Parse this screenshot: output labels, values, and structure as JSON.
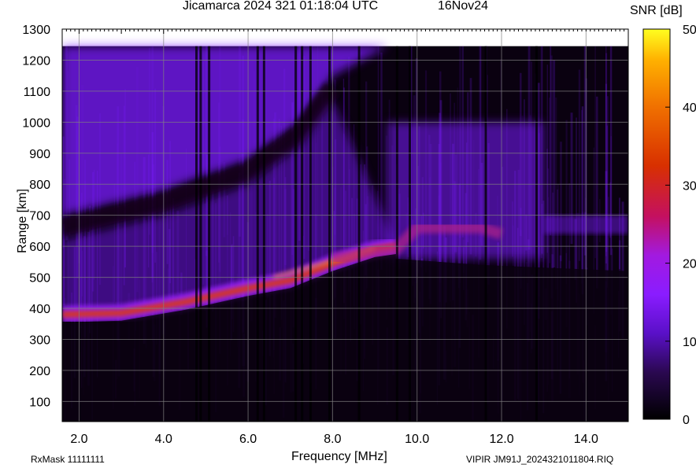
{
  "header": {
    "title": "Jicamarca 2024 321 01:18:04 UTC",
    "date": "16Nov24"
  },
  "footer": {
    "rxmask": "RxMask 11111111",
    "filename": "VIPIR  JM91J_2024321011804.RIQ"
  },
  "chart_data": {
    "type": "heatmap",
    "title": "Jicamarca 2024 321 01:18:04 UTC",
    "xlabel": "Frequency [MHz]",
    "ylabel": "Range [km]",
    "colorbar_label": "SNR [dB]",
    "xlim": [
      1.6,
      15.0
    ],
    "ylim": [
      35,
      1300
    ],
    "x_ticks": [
      2.0,
      4.0,
      6.0,
      8.0,
      10.0,
      12.0,
      14.0
    ],
    "x_tick_labels": [
      "2.0",
      "4.0",
      "6.0",
      "8.0",
      "10.0",
      "12.0",
      "14.0"
    ],
    "y_ticks": [
      100,
      200,
      300,
      400,
      500,
      600,
      700,
      800,
      900,
      1000,
      1100,
      1200,
      1300
    ],
    "colorbar_range": [
      0,
      50
    ],
    "colorbar_ticks": [
      0,
      10,
      20,
      30,
      40,
      50
    ],
    "grid": true,
    "colors": {
      "background": "#0a0110",
      "low": "#1a0530",
      "mid": "#7a1cff",
      "high": "#e03a00",
      "peak": "#ffd000"
    },
    "traces": {
      "o_trace_range_km": [
        [
          1.6,
          380
        ],
        [
          3.0,
          385
        ],
        [
          4.5,
          420
        ],
        [
          6.0,
          465
        ],
        [
          7.0,
          490
        ],
        [
          8.0,
          545
        ],
        [
          9.0,
          590
        ],
        [
          9.5,
          600
        ]
      ],
      "x_trace_range_km": [
        [
          8.0,
          560
        ],
        [
          9.5,
          590
        ],
        [
          10.0,
          660
        ],
        [
          11.5,
          660
        ],
        [
          12.0,
          640
        ]
      ],
      "upper_echo_range_km": [
        [
          1.6,
          700
        ],
        [
          4.0,
          780
        ],
        [
          6.0,
          880
        ],
        [
          7.2,
          1000
        ],
        [
          8.0,
          1150
        ]
      ]
    }
  }
}
